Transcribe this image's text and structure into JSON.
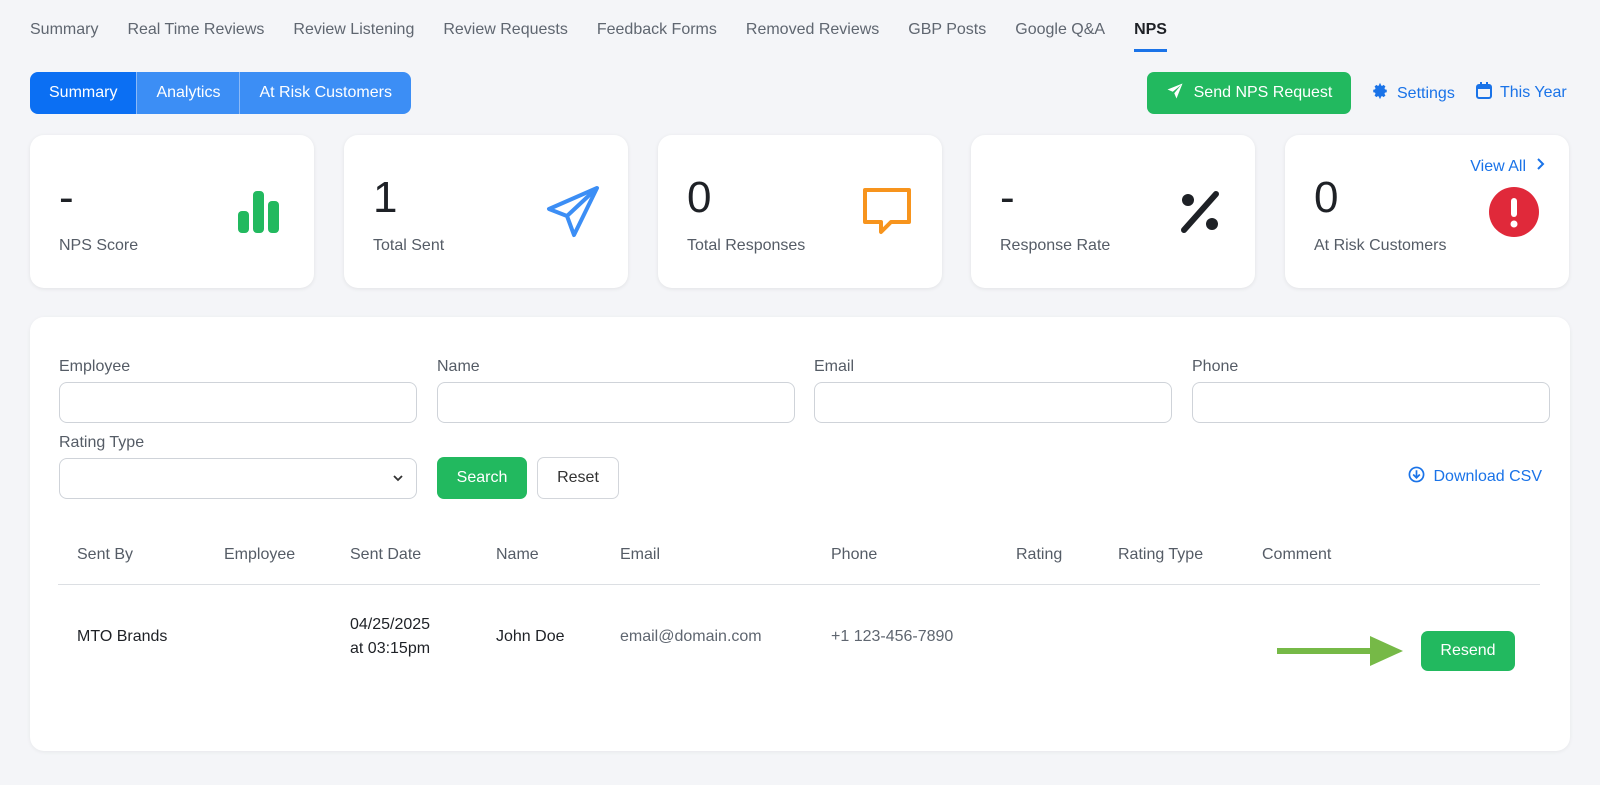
{
  "nav": {
    "tabs": [
      {
        "label": "Summary"
      },
      {
        "label": "Real Time Reviews"
      },
      {
        "label": "Review Listening"
      },
      {
        "label": "Review Requests"
      },
      {
        "label": "Feedback Forms"
      },
      {
        "label": "Removed Reviews"
      },
      {
        "label": "GBP Posts"
      },
      {
        "label": "Google Q&A"
      },
      {
        "label": "NPS"
      }
    ],
    "active_tab": "NPS"
  },
  "subtabs": [
    {
      "label": "Summary"
    },
    {
      "label": "Analytics"
    },
    {
      "label": "At Risk Customers"
    }
  ],
  "subtabs_active": "Summary",
  "actions": {
    "send_label": "Send NPS Request",
    "settings_label": "Settings",
    "period_label": "This Year"
  },
  "stats": [
    {
      "value": "-",
      "label": "NPS Score",
      "icon": "bar-chart-icon"
    },
    {
      "value": "1",
      "label": "Total Sent",
      "icon": "paper-plane-icon"
    },
    {
      "value": "0",
      "label": "Total Responses",
      "icon": "chat-bubble-icon"
    },
    {
      "value": "-",
      "label": "Response Rate",
      "icon": "percent-icon"
    },
    {
      "value": "0",
      "label": "At Risk Customers",
      "icon": "alert-icon",
      "link": "View All"
    }
  ],
  "filters": {
    "employee_label": "Employee",
    "name_label": "Name",
    "email_label": "Email",
    "phone_label": "Phone",
    "rating_type_label": "Rating Type",
    "rating_type_value": "",
    "search_label": "Search",
    "reset_label": "Reset",
    "download_label": "Download CSV"
  },
  "table": {
    "columns": [
      "Sent By",
      "Employee",
      "Sent Date",
      "Name",
      "Email",
      "Phone",
      "Rating",
      "Rating Type",
      "Comment"
    ],
    "rows": [
      {
        "sent_by": "MTO Brands",
        "employee": "",
        "sent_date_line1": "04/25/2025",
        "sent_date_line2": "at 03:15pm",
        "name": "John Doe",
        "email": "email@domain.com",
        "phone": "+1 123-456-7890",
        "rating": "",
        "rating_type": "",
        "comment": "",
        "action_label": "Resend"
      }
    ]
  },
  "colors": {
    "primary_blue": "#1a73e8",
    "green": "#22b95f",
    "orange": "#f7941d",
    "red": "#e0293a"
  }
}
